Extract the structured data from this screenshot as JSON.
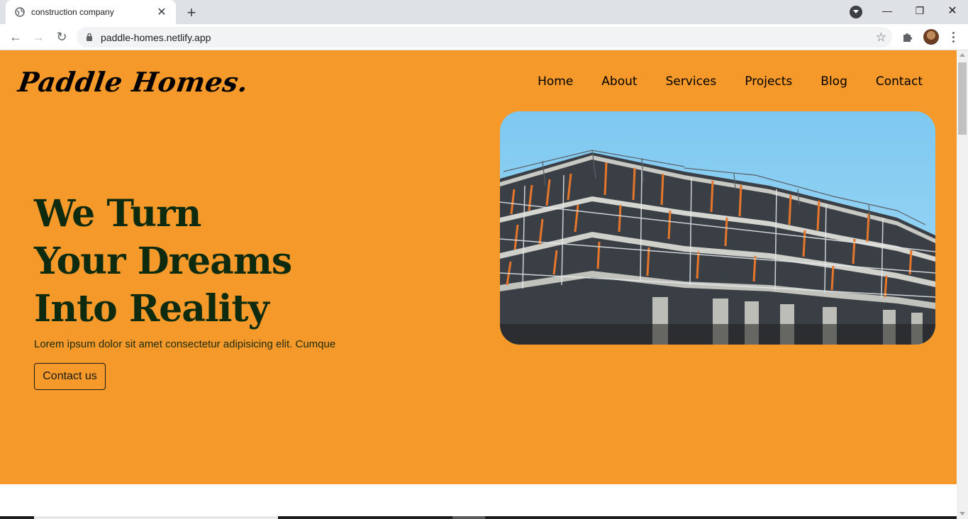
{
  "browser": {
    "tab_title": "construction company",
    "tab_close": "✕",
    "new_tab": "+",
    "url": "paddle-homes.netlify.app",
    "back": "←",
    "forward": "→",
    "reload": "↻",
    "bookmark": "☆",
    "minimize": "—",
    "maximize": "❐",
    "close": "✕"
  },
  "site": {
    "logo": "Paddle Homes.",
    "nav": [
      "Home",
      "About",
      "Services",
      "Projects",
      "Blog",
      "Contact"
    ],
    "hero": {
      "headline": [
        "We Turn",
        "Your Dreams",
        "Into Reality"
      ],
      "lede": "Lorem ipsum dolor sit amet consectetur adipisicing elit. Cumque",
      "cta": "Contact us"
    }
  },
  "colors": {
    "hero_bg": "#f4992a",
    "headline": "#0f2b0f"
  }
}
